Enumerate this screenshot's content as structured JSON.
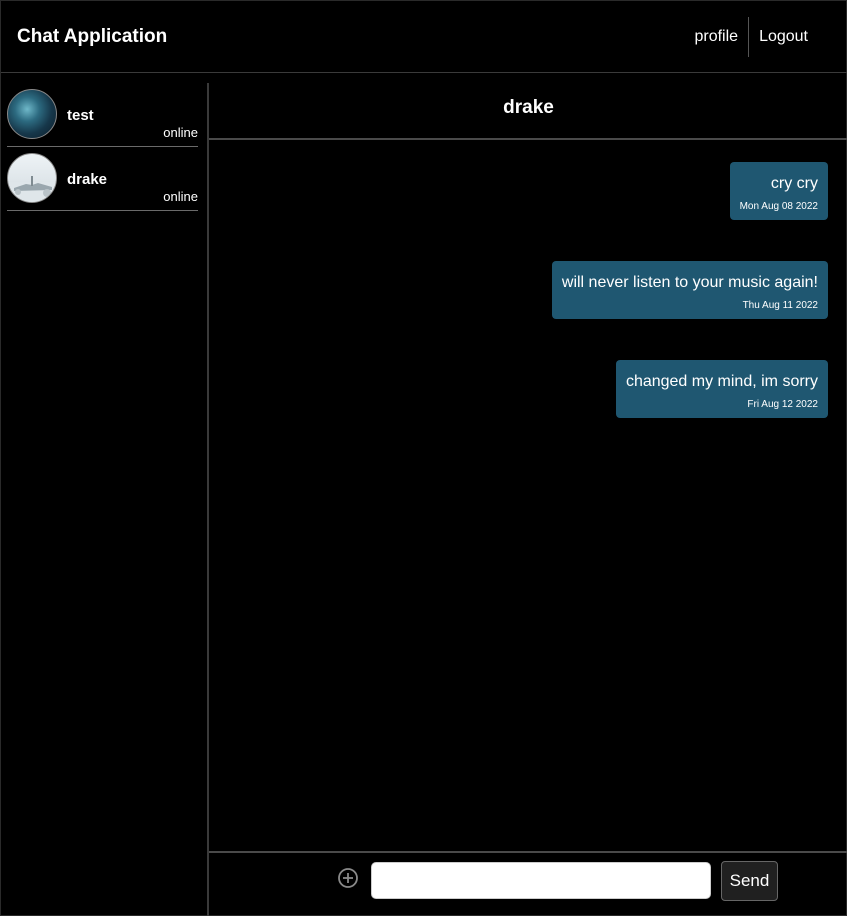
{
  "header": {
    "title": "Chat Application",
    "nav": {
      "profile": "profile",
      "logout": "Logout"
    }
  },
  "sidebar": {
    "users": [
      {
        "name": "test",
        "status": "online"
      },
      {
        "name": "drake",
        "status": "online"
      }
    ]
  },
  "chat": {
    "title": "drake",
    "messages": [
      {
        "text": "cry cry",
        "date": "Mon Aug 08 2022"
      },
      {
        "text": "will never listen to your music again!",
        "date": "Thu Aug 11 2022"
      },
      {
        "text": "changed my mind, im sorry",
        "date": "Fri Aug 12 2022"
      }
    ],
    "composer": {
      "input_value": "",
      "send_label": "Send",
      "attach_icon": "plus-circle-icon"
    }
  },
  "colors": {
    "background": "#000000",
    "bubble": "#1f5771",
    "divider": "#3a3a3a"
  }
}
